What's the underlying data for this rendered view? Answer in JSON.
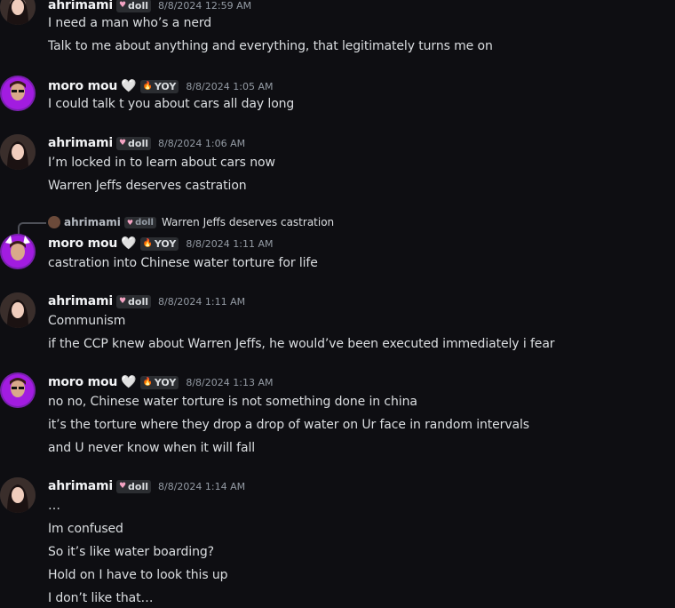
{
  "users": {
    "ahrimami": {
      "name": "ahrimami",
      "tag": "doll"
    },
    "moro": {
      "name": "moro mou",
      "tag": "YOY",
      "heart": "🤍"
    }
  },
  "colors": {
    "background": "#0e0e12",
    "doll_tag": "#f4a3c3",
    "yoy_tag": "#ff6b4a"
  },
  "messages": [
    {
      "user": "ahrimami",
      "timestamp": "8/8/2024 12:59 AM",
      "lines": [
        "I need a man who’s a nerd",
        "Talk to me about anything and everything, that legitimately turns me on"
      ]
    },
    {
      "user": "moro mou",
      "timestamp": "8/8/2024 1:05 AM",
      "lines": [
        "I could talk t you about cars all day long"
      ]
    },
    {
      "user": "ahrimami",
      "timestamp": "8/8/2024 1:06 AM",
      "lines": [
        "I’m locked in to learn about cars now",
        "Warren Jeffs deserves castration"
      ]
    },
    {
      "user": "moro mou",
      "timestamp": "8/8/2024 1:11 AM",
      "reply": {
        "name": "ahrimami",
        "tag": "doll",
        "text": "Warren Jeffs deserves castration"
      },
      "lines": [
        "castration into Chinese water torture for life"
      ]
    },
    {
      "user": "ahrimami",
      "timestamp": "8/8/2024 1:11 AM",
      "lines": [
        "Communism",
        "if the CCP knew about Warren Jeffs, he would’ve been executed immediately i fear"
      ]
    },
    {
      "user": "moro mou",
      "timestamp": "8/8/2024 1:13 AM",
      "lines": [
        "no no, Chinese water torture is not something done in china",
        "it’s the torture where they drop a drop of water on Ur face in random intervals",
        "and U never know when it will fall"
      ]
    },
    {
      "user": "ahrimami",
      "timestamp": "8/8/2024 1:14 AM",
      "lines": [
        "…",
        "Im confused",
        "So it’s like water boarding?",
        "Hold on I have to look this up",
        "I don’t like that…"
      ]
    }
  ]
}
